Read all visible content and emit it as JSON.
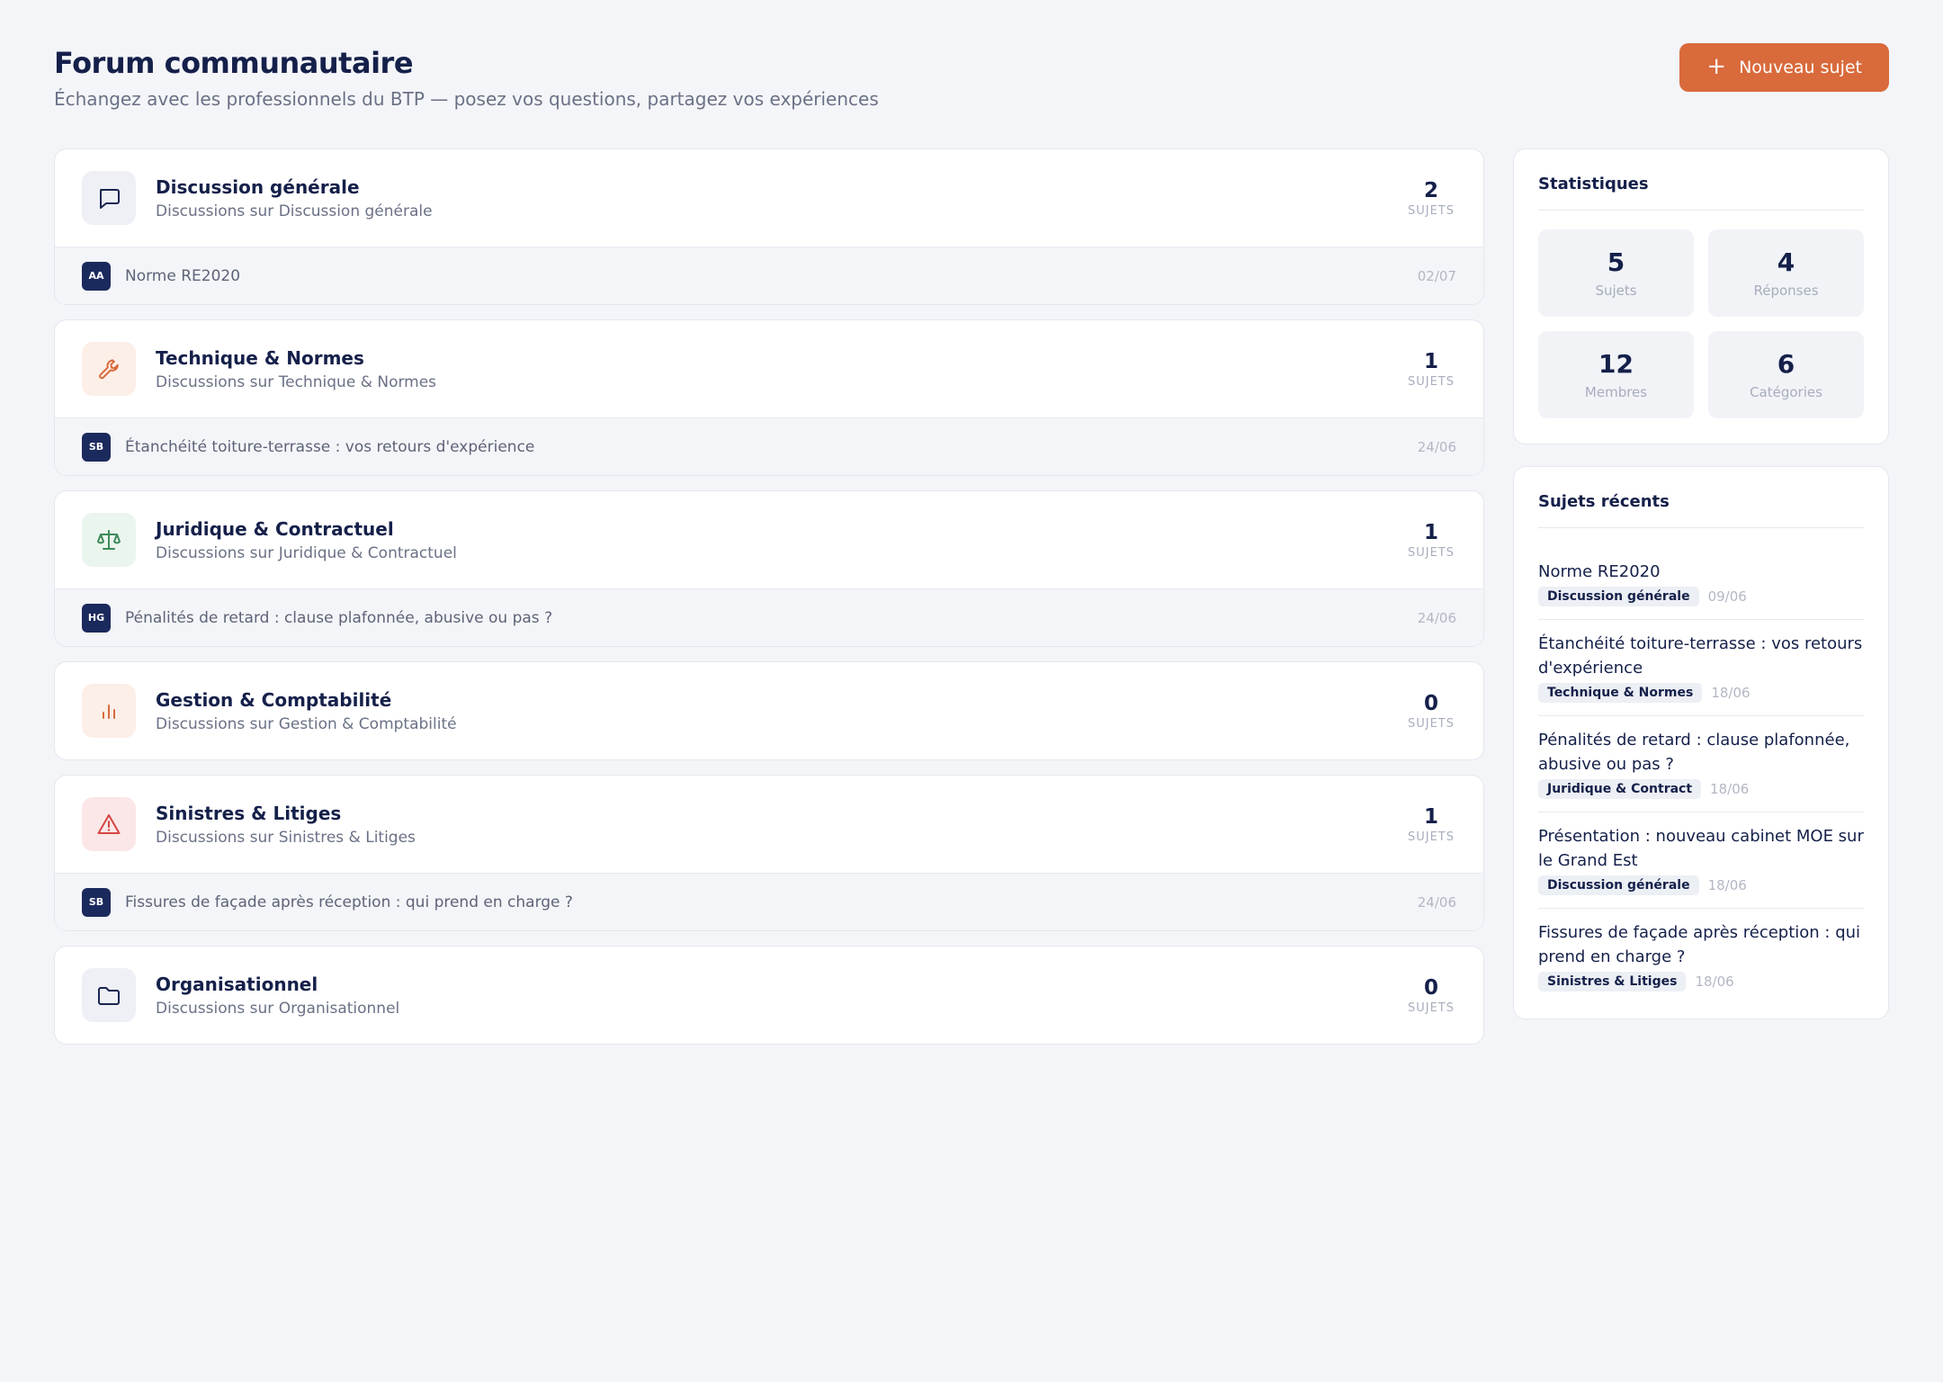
{
  "header": {
    "title": "Forum communautaire",
    "subtitle": "Échangez avec les professionnels du BTP — posez vos questions, partagez vos expériences",
    "new_button": {
      "icon": "+",
      "label": "Nouveau sujet"
    }
  },
  "categories": [
    {
      "name": "Discussion générale",
      "desc": "Discussions sur Discussion générale",
      "count": "2",
      "count_label": "SUJETS",
      "icon": "chat-bubble-icon",
      "icon_color": "#1b2552",
      "icon_bg": "#eef0f5",
      "last": {
        "avatar": "AA",
        "title": "Norme RE2020",
        "date": "02/07"
      }
    },
    {
      "name": "Technique & Normes",
      "desc": "Discussions sur Technique & Normes",
      "count": "1",
      "count_label": "SUJETS",
      "icon": "wrench-icon",
      "icon_color": "#d96a3b",
      "icon_bg": "#fcefe8",
      "last": {
        "avatar": "SB",
        "title": "Étanchéité toiture-terrasse : vos retours d'expérience",
        "date": "24/06"
      }
    },
    {
      "name": "Juridique & Contractuel",
      "desc": "Discussions sur Juridique & Contractuel",
      "count": "1",
      "count_label": "SUJETS",
      "icon": "scale-icon",
      "icon_color": "#3d8a5a",
      "icon_bg": "#eaf5ee",
      "last": {
        "avatar": "HG",
        "title": "Pénalités de retard : clause plafonnée, abusive ou pas ?",
        "date": "24/06"
      }
    },
    {
      "name": "Gestion & Comptabilité",
      "desc": "Discussions sur Gestion & Comptabilité",
      "count": "0",
      "count_label": "SUJETS",
      "icon": "bar-chart-icon",
      "icon_color": "#d96a3b",
      "icon_bg": "#fcefe8",
      "last": null
    },
    {
      "name": "Sinistres & Litiges",
      "desc": "Discussions sur Sinistres & Litiges",
      "count": "1",
      "count_label": "SUJETS",
      "icon": "warning-icon",
      "icon_color": "#d64545",
      "icon_bg": "#fbe7e7",
      "last": {
        "avatar": "SB",
        "title": "Fissures de façade après réception : qui prend en charge ?",
        "date": "24/06"
      }
    },
    {
      "name": "Organisationnel",
      "desc": "Discussions sur Organisationnel",
      "count": "0",
      "count_label": "SUJETS",
      "icon": "folder-icon",
      "icon_color": "#1b2552",
      "icon_bg": "#eef0f5",
      "last": null
    }
  ],
  "stats": {
    "title": "Statistiques",
    "items": [
      {
        "value": "5",
        "label": "Sujets"
      },
      {
        "value": "4",
        "label": "Réponses"
      },
      {
        "value": "12",
        "label": "Membres"
      },
      {
        "value": "6",
        "label": "Catégories"
      }
    ]
  },
  "recent": {
    "title": "Sujets récents",
    "items": [
      {
        "title": "Norme RE2020",
        "tag": "Discussion générale",
        "date": "09/06"
      },
      {
        "title": "Étanchéité toiture-terrasse : vos retours d'expérience",
        "tag": "Technique & Normes",
        "date": "18/06"
      },
      {
        "title": "Pénalités de retard : clause plafonnée, abusive ou pas ?",
        "tag": "Juridique & Contract",
        "date": "18/06"
      },
      {
        "title": "Présentation : nouveau cabinet MOE sur le Grand Est",
        "tag": "Discussion générale",
        "date": "18/06"
      },
      {
        "title": "Fissures de façade après réception : qui prend en charge ?",
        "tag": "Sinistres & Litiges",
        "date": "18/06"
      }
    ]
  }
}
